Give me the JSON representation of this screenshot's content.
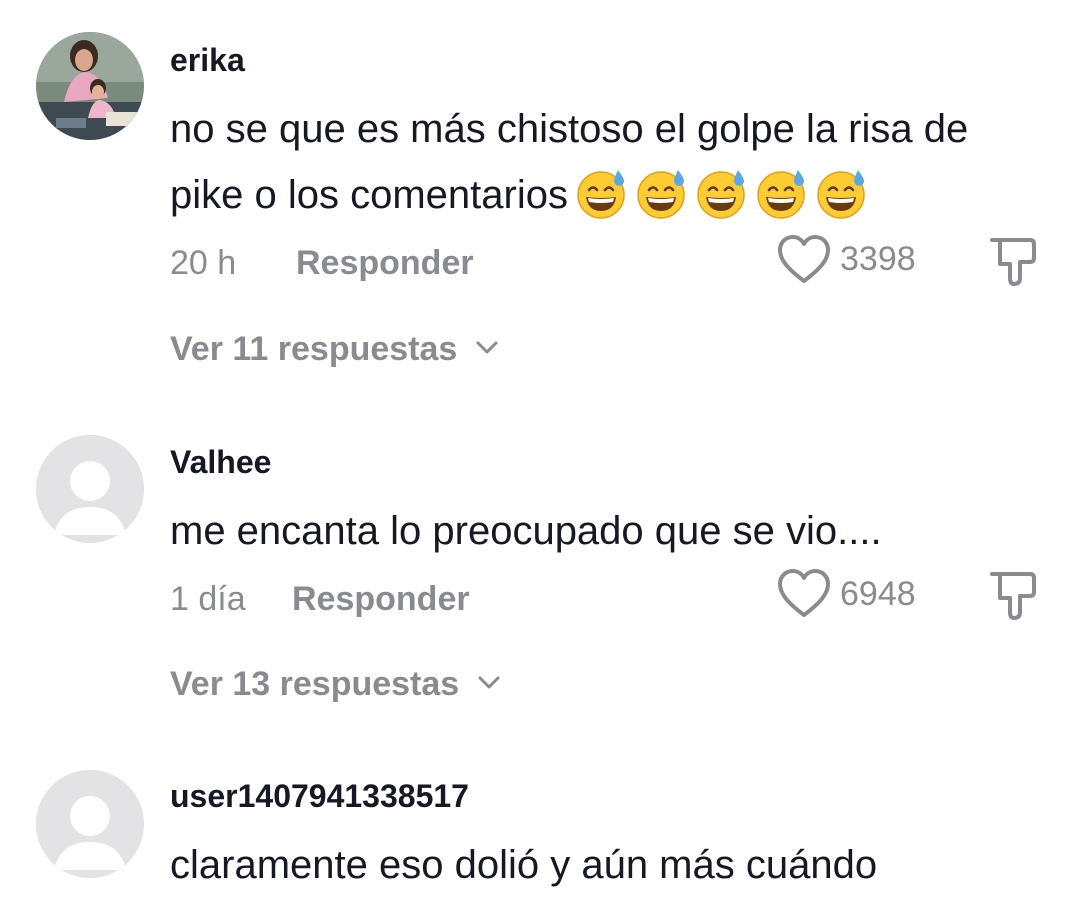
{
  "comments": [
    {
      "username": "erika",
      "text": "no se que es más chistoso el golpe la risa de pike o los comentarios",
      "emoji_icon": "grinning-face-with-sweat-icon",
      "emoji_count": 5,
      "time": "20 h",
      "reply_label": "Responder",
      "likes": "3398",
      "view_replies": "Ver 11 respuestas",
      "avatar_icon": "profile-photo"
    },
    {
      "username": "Valhee",
      "text": "me encanta lo preocupado que se vio....",
      "time": "1 día",
      "reply_label": "Responder",
      "likes": "6948",
      "view_replies": "Ver 13 respuestas",
      "avatar_icon": "default-avatar-icon"
    },
    {
      "username": "user1407941338517",
      "text": "claramente eso dolió y aún más cuándo",
      "avatar_icon": "default-avatar-icon"
    }
  ],
  "icons": {
    "like": "heart-outline-icon",
    "dislike": "thumbs-down-icon",
    "expand": "chevron-down-icon"
  },
  "colors": {
    "text_primary": "#161823",
    "text_secondary": "#8a8b91",
    "avatar_placeholder": "#e3e3e5"
  }
}
